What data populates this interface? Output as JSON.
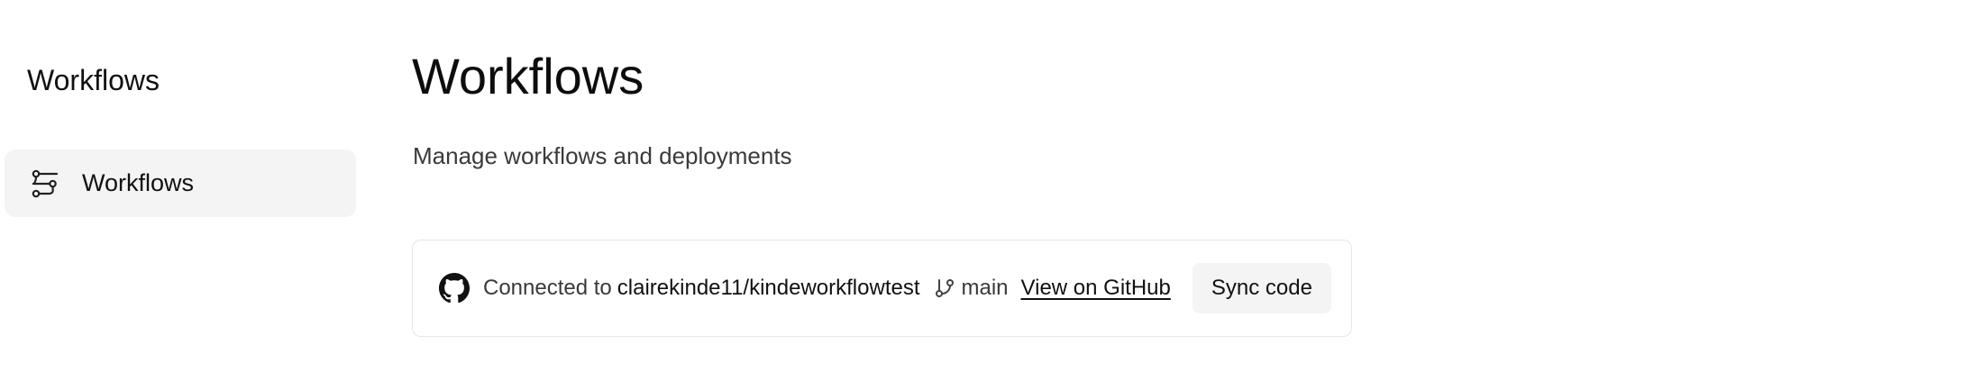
{
  "sidebar": {
    "title": "Workflows",
    "items": [
      {
        "label": "Workflows",
        "icon": "workflow-icon",
        "active": true
      }
    ]
  },
  "main": {
    "title": "Workflows",
    "subtitle": "Manage workflows and deployments"
  },
  "repo": {
    "connected_prefix": "Connected to",
    "repo_name": "clairekinde11/kindeworkflowtest",
    "branch": "main",
    "github_link_label": "View on GitHub",
    "sync_label": "Sync code",
    "icons": {
      "provider": "github-icon",
      "branch": "git-branch-icon"
    }
  },
  "colors": {
    "sidebar_item_bg": "#f4f4f4",
    "card_border": "#e6e6e6",
    "button_bg": "#f4f4f4",
    "text_primary": "#111111",
    "text_secondary": "#3a3a3a"
  }
}
